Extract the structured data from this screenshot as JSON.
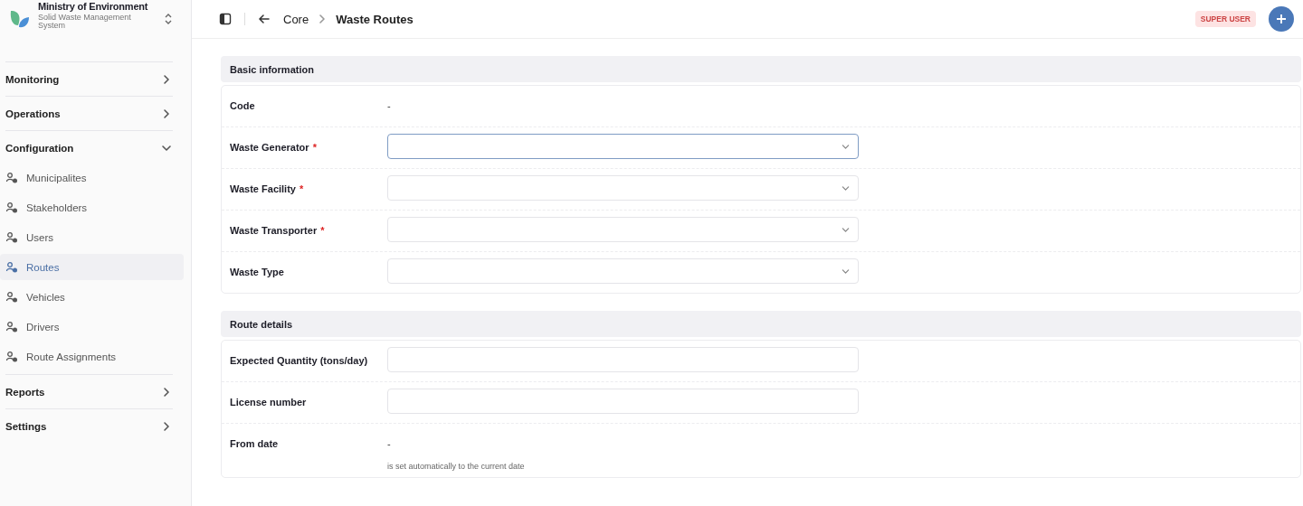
{
  "sidebar": {
    "org_name": "Ministry of Environment",
    "org_subtitle": "Solid Waste Management System",
    "groups": [
      {
        "label": "Monitoring",
        "expanded": false
      },
      {
        "label": "Operations",
        "expanded": false
      },
      {
        "label": "Configuration",
        "expanded": true,
        "items": [
          {
            "label": "Municipalites",
            "selected": false
          },
          {
            "label": "Stakeholders",
            "selected": false
          },
          {
            "label": "Users",
            "selected": false
          },
          {
            "label": "Routes",
            "selected": true
          },
          {
            "label": "Vehicles",
            "selected": false
          },
          {
            "label": "Drivers",
            "selected": false
          },
          {
            "label": "Route Assignments",
            "selected": false
          }
        ]
      },
      {
        "label": "Reports",
        "expanded": false
      },
      {
        "label": "Settings",
        "expanded": false
      }
    ]
  },
  "header": {
    "breadcrumb": [
      "Core",
      "Waste Routes"
    ],
    "role_badge": "SUPER USER"
  },
  "sections": [
    {
      "title": "Basic information",
      "fields": [
        {
          "kind": "readonly",
          "label": "Code",
          "value": "-"
        },
        {
          "kind": "select",
          "label": "Waste Generator",
          "required_mark": "*",
          "focused": true
        },
        {
          "kind": "select",
          "label": "Waste Facility",
          "required_mark": "*",
          "focused": false
        },
        {
          "kind": "select",
          "label": "Waste Transporter",
          "required_mark": "*",
          "focused": false
        },
        {
          "kind": "select",
          "label": "Waste Type",
          "focused": false
        }
      ]
    },
    {
      "title": "Route details",
      "fields": [
        {
          "kind": "input",
          "label": "Expected Quantity (tons/day)",
          "focused": false
        },
        {
          "kind": "input",
          "label": "License number",
          "focused": false
        },
        {
          "kind": "readonly",
          "label": "From date",
          "value": "-",
          "hint": "is set automatically to the current date"
        }
      ]
    }
  ]
}
